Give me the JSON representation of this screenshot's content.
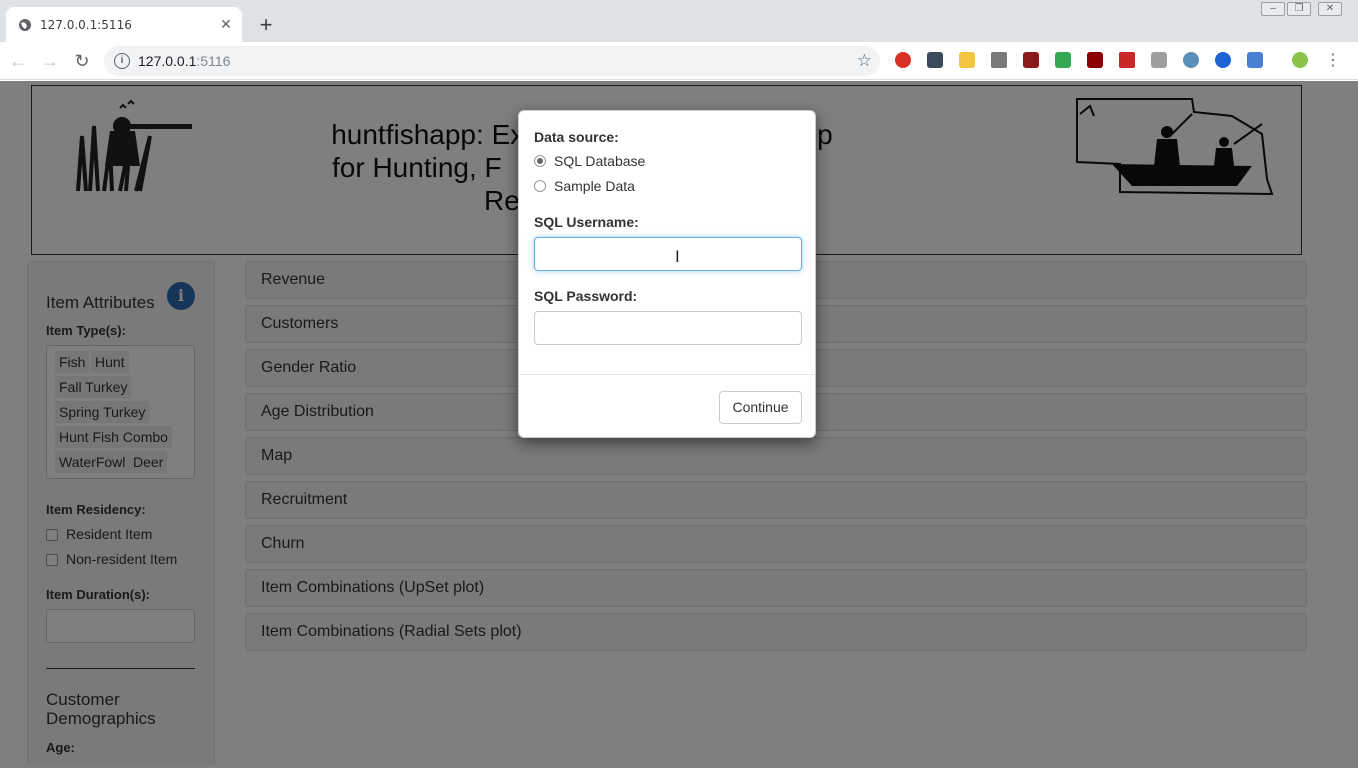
{
  "browser": {
    "tab_title": "127.0.0.1:5116",
    "url_host": "127.0.0.1",
    "url_port": ":5116"
  },
  "banner": {
    "title_line1": "huntfishapp: Explo",
    "title_line1_end": "pp",
    "title_line2": "for Hunting, F",
    "title_line3": "Re"
  },
  "sidebar": {
    "item_attributes_heading": "Item Attributes",
    "item_types_label": "Item Type(s):",
    "item_types": [
      "Fish",
      "Hunt",
      "Fall Turkey",
      "Spring Turkey",
      "Hunt Fish Combo",
      "WaterFowl",
      "Deer"
    ],
    "residency_label": "Item Residency:",
    "residency_options": [
      "Resident Item",
      "Non-resident Item"
    ],
    "duration_label": "Item Duration(s):",
    "demographics_heading": "Customer Demographics",
    "age_label": "Age:"
  },
  "panels": [
    "Revenue",
    "Customers",
    "Gender Ratio",
    "Age Distribution",
    "Map",
    "Recruitment",
    "Churn",
    "Item Combinations (UpSet plot)",
    "Item Combinations (Radial Sets plot)"
  ],
  "modal": {
    "data_source_label": "Data source:",
    "options": [
      "SQL Database",
      "Sample Data"
    ],
    "selected_option": "SQL Database",
    "username_label": "SQL Username:",
    "username_value": "",
    "password_label": "SQL Password:",
    "password_value": "",
    "continue_label": "Continue"
  },
  "colors": {
    "info_icon": "#2b6cb0",
    "focus_border": "#66afe9"
  }
}
